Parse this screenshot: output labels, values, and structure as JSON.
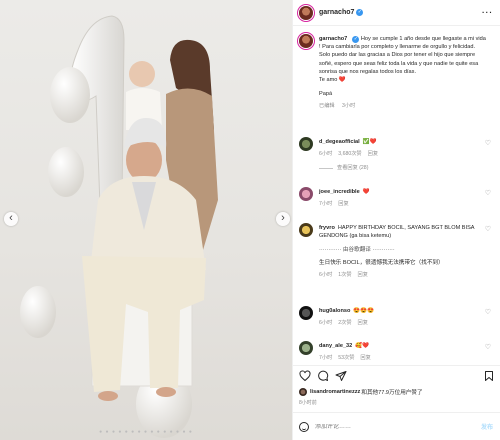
{
  "post": {
    "username": "garnacho7",
    "verified": true,
    "caption_lines": [
      "Hoy se cumple 1 año desde que llegaste a mi vida",
      "! Para cambiarla por completo y llenarme de orgullo y felicidad.",
      "Solo puedo dar las gracias a Dios por tener el hijo que siempre",
      "soñé, espero que seas feliz toda la vida y que nadie te quite esa",
      "sonrisa que nos regalas todos los días.",
      "Te amo ❤️"
    ],
    "signature": "Papá",
    "caption_meta": {
      "edited": "已编辑",
      "time": "3小时"
    },
    "replies_toggle": "查看回复 (28)"
  },
  "comments": [
    {
      "user": "d_degeaofficial",
      "text": "",
      "extra": "✅❤️",
      "time": "6小时",
      "likes": "3,680次赞",
      "reply": "回复"
    },
    {
      "user": "joee_incredible",
      "text": "",
      "extra": "❤️",
      "time": "7小时",
      "likes": "",
      "reply": "回复"
    },
    {
      "user": "fryvro",
      "text": "HAPPY BIRTHDAY BOCIL, SAYANG BGT BLOM BISA GENDONG (ga bisa ketemu)",
      "translation_label": "············ 由谷歌翻译 ············",
      "translation": "生日快乐 BOCIL，很遗憾我无法携带它（找不到）",
      "time": "6小时",
      "likes": "1次赞",
      "reply": "回复"
    },
    {
      "user": "hug0alonso",
      "text": "",
      "extra": "😍😍😍",
      "time": "6小时",
      "likes": "2次赞",
      "reply": "回复"
    },
    {
      "user": "dany_ale_32",
      "text": "",
      "extra": "🥰❤️",
      "time": "7小时",
      "likes": "53次赞",
      "reply": "回复"
    }
  ],
  "likes_line": {
    "user": "lisandromartinezzz",
    "text": "和其他77.9万位用户赞了"
  },
  "post_date": "8小时前",
  "comment_input": {
    "placeholder": "添加评论……",
    "post_label": "发布"
  },
  "nav": {
    "left": "‹",
    "right": "›",
    "pager_dots": "● ● ● ● ● ● ● ● ● ● ● ● ● ● ●"
  },
  "colors": {
    "verified": "#3897f0",
    "heart": "#ed4956",
    "meta": "#8e8e8e",
    "post_button": "#b2dffc"
  }
}
